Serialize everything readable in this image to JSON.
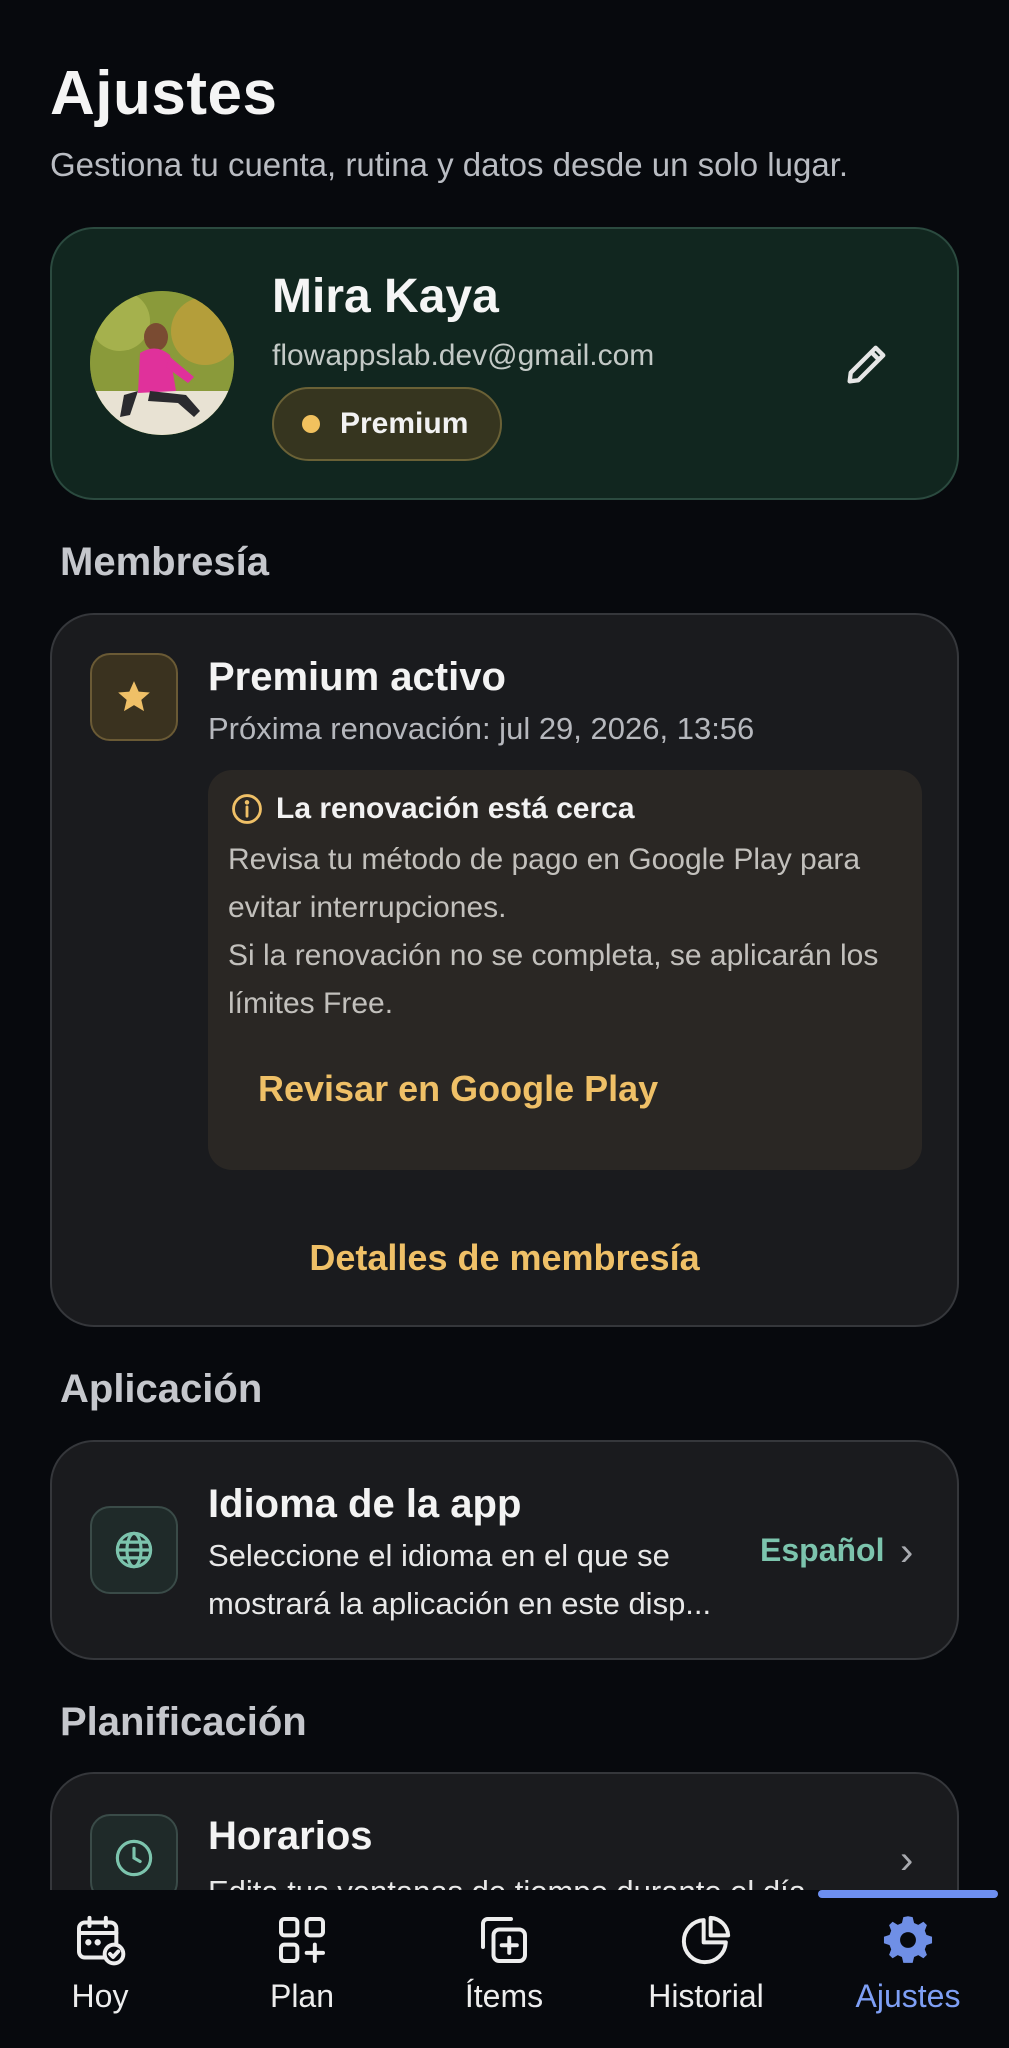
{
  "header": {
    "title": "Ajustes",
    "subtitle": "Gestiona tu cuenta, rutina y datos desde un solo lugar."
  },
  "profile": {
    "name": "Mira Kaya",
    "email": "flowappslab.dev@gmail.com",
    "badge": "Premium"
  },
  "sections": {
    "membership": "Membresía",
    "application": "Aplicación",
    "planning": "Planificación"
  },
  "membership": {
    "title": "Premium activo",
    "renewal": "Próxima renovación: jul 29, 2026, 13:56",
    "warning_title": "La renovación está cerca",
    "warning_text_1": "Revisa tu método de pago en Google Play para evitar interrupciones.",
    "warning_text_2": "Si la renovación no se completa, se aplicarán los límites Free.",
    "review_link": "Revisar en Google Play",
    "details_link": "Detalles de membresía"
  },
  "language": {
    "title": "Idioma de la app",
    "description": "Seleccione el idioma en el que se mostrará la aplicación en este disp...",
    "value": "Español",
    "chevron": "›"
  },
  "schedules": {
    "title": "Horarios",
    "description": "Edita tus ventanas de tiempo durante el día",
    "chevron": "›"
  },
  "nav": {
    "items": [
      {
        "label": "Hoy",
        "icon": "calendar-check-icon"
      },
      {
        "label": "Plan",
        "icon": "grid-plus-icon"
      },
      {
        "label": "Ítems",
        "icon": "copy-plus-icon"
      },
      {
        "label": "Historial",
        "icon": "pie-chart-icon"
      },
      {
        "label": "Ajustes",
        "icon": "gear-icon"
      }
    ],
    "active_index": 4
  },
  "colors": {
    "accent": "#efc067",
    "teal": "#7cc4ad",
    "nav_active": "#7e9ff5",
    "background": "#07090d"
  }
}
